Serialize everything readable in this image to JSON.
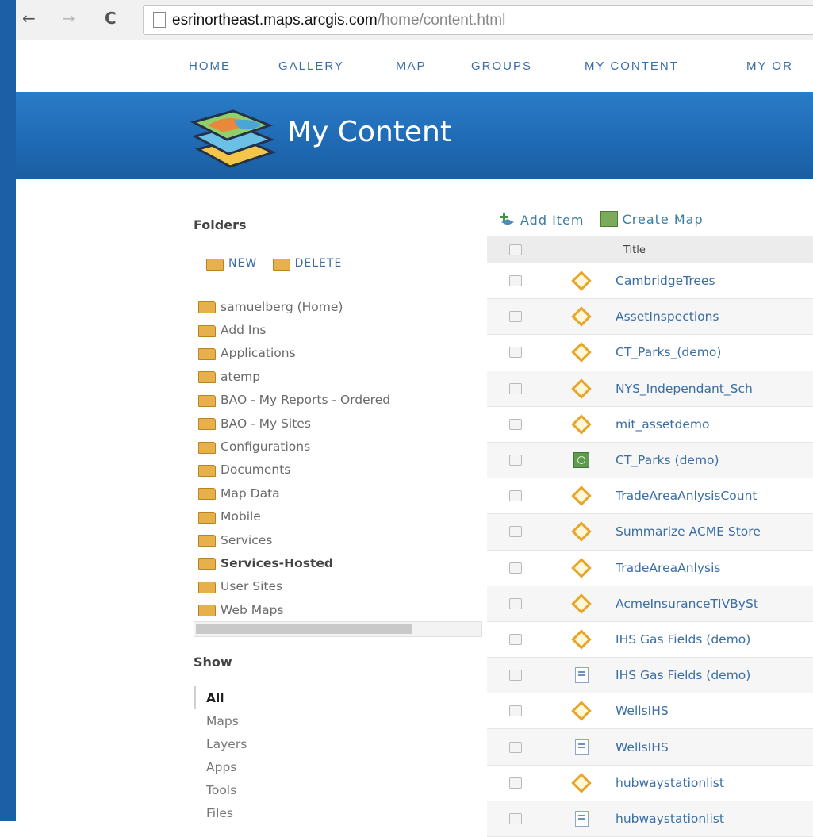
{
  "browser": {
    "back_glyph": "←",
    "forward_glyph": "→",
    "reload_glyph": "C",
    "url_host": "esrinortheast.maps.arcgis.com",
    "url_path": "/home/content.html"
  },
  "topnav": {
    "items": [
      "HOME",
      "GALLERY",
      "MAP",
      "GROUPS",
      "MY CONTENT",
      "MY OR"
    ]
  },
  "banner": {
    "title": "My Content"
  },
  "sidebar": {
    "folders_heading": "Folders",
    "new_label": "NEW",
    "delete_label": "DELETE",
    "folders": [
      "samuelberg (Home)",
      "Add Ins",
      "Applications",
      "atemp",
      "BAO - My Reports - Ordered",
      "BAO - My Sites",
      "Configurations",
      "Documents",
      "Map Data",
      "Mobile",
      "Services",
      "Services-Hosted",
      "User Sites",
      "Web Maps"
    ],
    "selected_folder": "Services-Hosted",
    "show_heading": "Show",
    "show_items": [
      "All",
      "Maps",
      "Layers",
      "Apps",
      "Tools",
      "Files"
    ],
    "active_show": "All"
  },
  "content": {
    "toolbar": {
      "add_item": "Add Item",
      "create_map": "Create Map"
    },
    "table_header": {
      "title": "Title"
    },
    "rows": [
      {
        "icon": "feature-layer-icon",
        "title": "CambridgeTrees"
      },
      {
        "icon": "feature-layer-icon",
        "title": "AssetInspections"
      },
      {
        "icon": "feature-layer-icon",
        "title": "CT_Parks_(demo)"
      },
      {
        "icon": "feature-layer-icon",
        "title": "NYS_Independant_Sch"
      },
      {
        "icon": "feature-layer-icon",
        "title": "mit_assetdemo"
      },
      {
        "icon": "web-map-icon",
        "title": "CT_Parks (demo)"
      },
      {
        "icon": "feature-layer-icon",
        "title": "TradeAreaAnlysisCount"
      },
      {
        "icon": "feature-layer-icon",
        "title": "Summarize ACME Store"
      },
      {
        "icon": "feature-layer-icon",
        "title": "TradeAreaAnlysis"
      },
      {
        "icon": "feature-layer-icon",
        "title": "AcmeInsuranceTIVBySt"
      },
      {
        "icon": "feature-layer-icon",
        "title": "IHS Gas Fields (demo)"
      },
      {
        "icon": "document-icon",
        "title": "IHS Gas Fields (demo)"
      },
      {
        "icon": "feature-layer-icon",
        "title": "WellsIHS"
      },
      {
        "icon": "document-icon",
        "title": "WellsIHS"
      },
      {
        "icon": "feature-layer-icon",
        "title": "hubwaystationlist"
      },
      {
        "icon": "document-icon",
        "title": "hubwaystationlist"
      }
    ]
  },
  "colors": {
    "banner_blue": "#1f69b3",
    "link_blue": "#3a6ea5",
    "layer_icon_orange": "#e7a52a",
    "folder_yellow": "#e8b04a"
  }
}
